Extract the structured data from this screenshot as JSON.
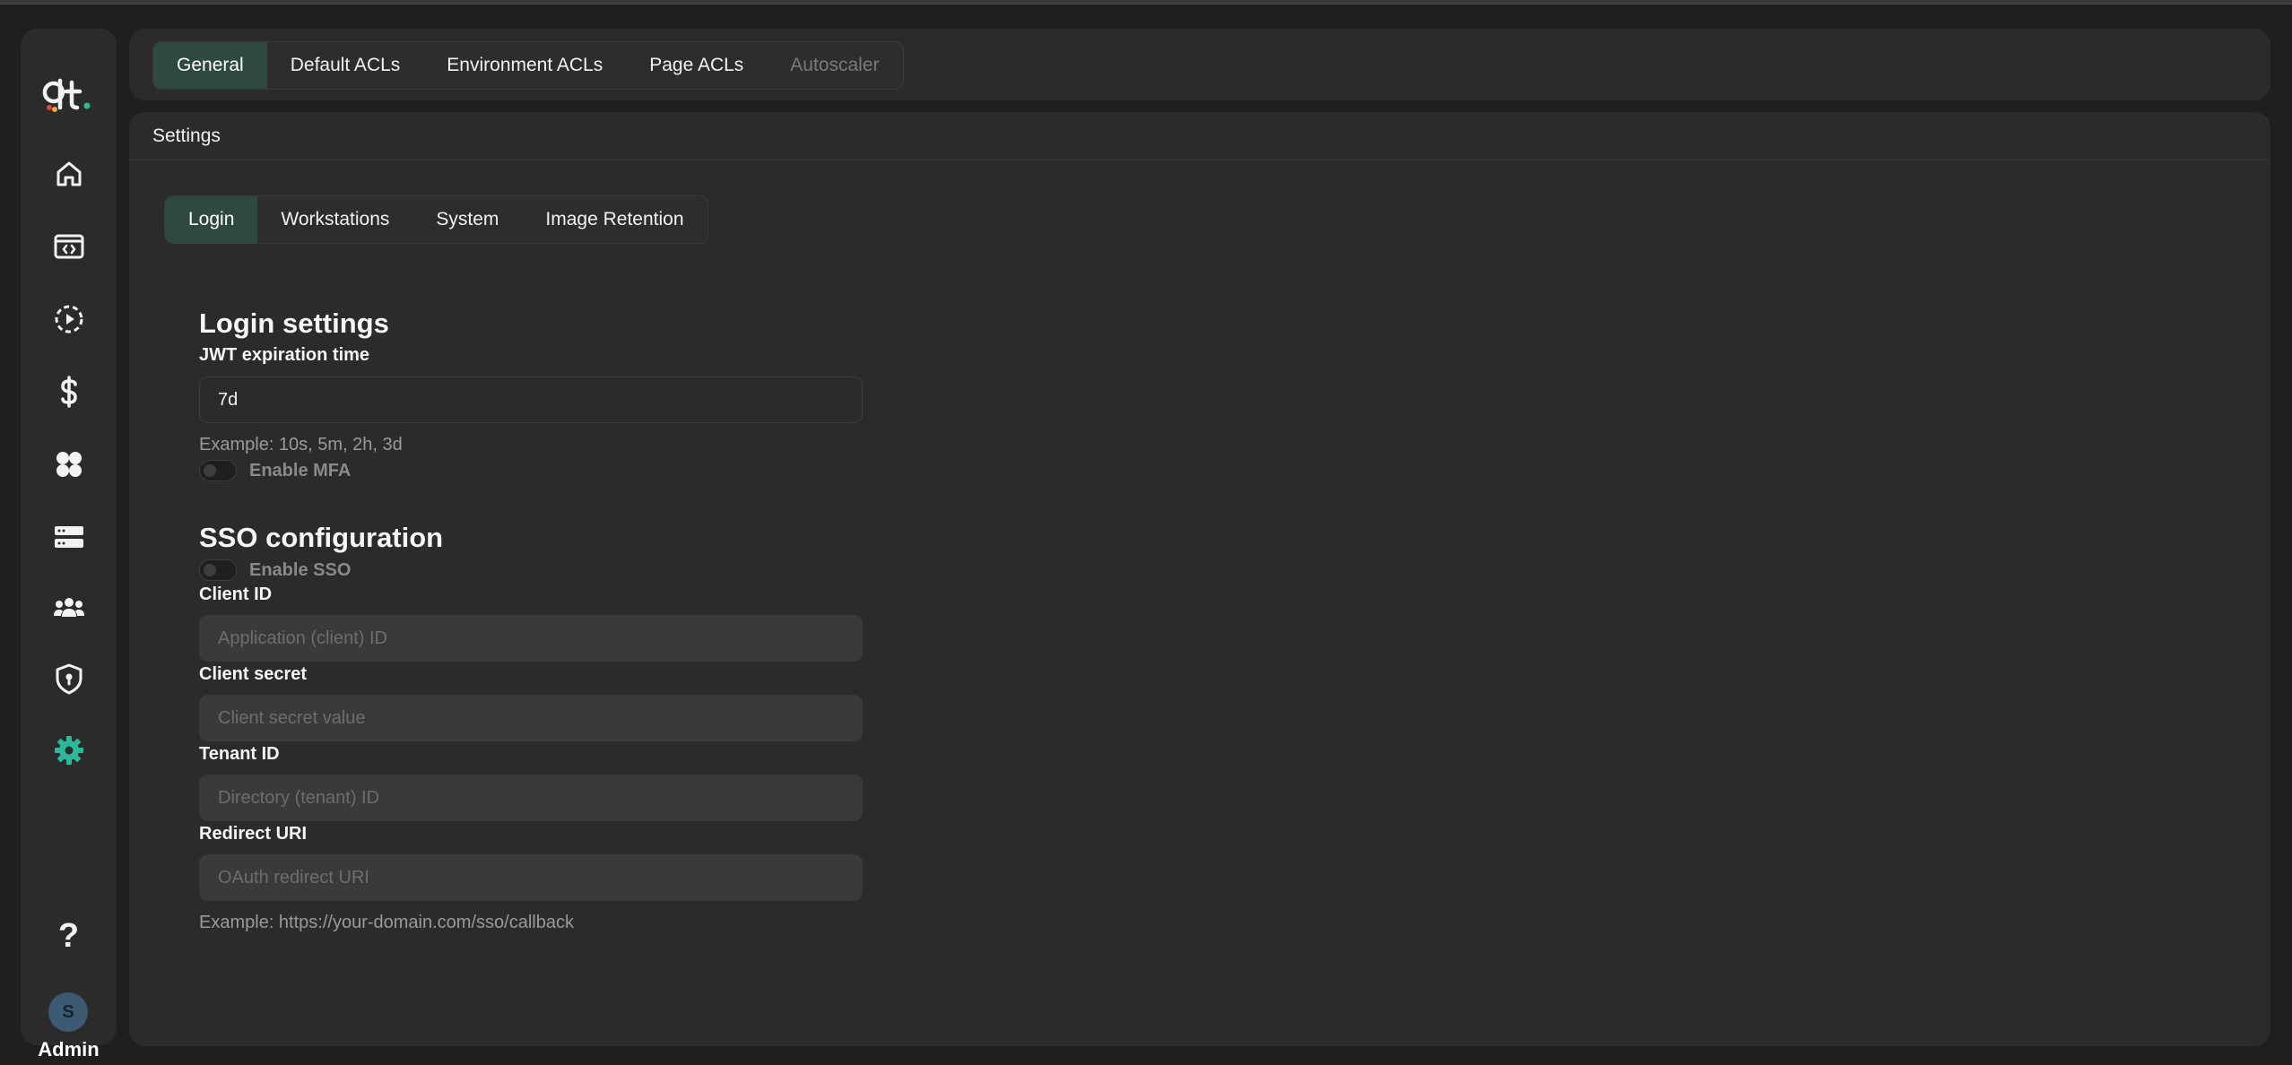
{
  "user": {
    "initial": "S",
    "role": "Admin"
  },
  "colors": {
    "accent": "#2eb89a",
    "active_tab": "#2e4a3e"
  },
  "sidebar": {
    "items": [
      {
        "icon": "home-icon"
      },
      {
        "icon": "code-window-icon"
      },
      {
        "icon": "session-play-icon"
      },
      {
        "icon": "dollar-icon"
      },
      {
        "icon": "apps-grid-icon"
      },
      {
        "icon": "server-icon"
      },
      {
        "icon": "users-icon"
      },
      {
        "icon": "shield-lock-icon"
      },
      {
        "icon": "gear-icon",
        "active": true
      },
      {
        "icon": "help-icon",
        "label": "?"
      }
    ]
  },
  "top_tabs": [
    {
      "label": "General",
      "active": true
    },
    {
      "label": "Default ACLs"
    },
    {
      "label": "Environment ACLs"
    },
    {
      "label": "Page ACLs"
    },
    {
      "label": "Autoscaler",
      "disabled": true
    }
  ],
  "card": {
    "title": "Settings"
  },
  "sub_tabs": [
    {
      "label": "Login",
      "active": true
    },
    {
      "label": "Workstations"
    },
    {
      "label": "System"
    },
    {
      "label": "Image Retention"
    }
  ],
  "login": {
    "title": "Login settings",
    "jwt_label": "JWT expiration time",
    "jwt_value": "7d",
    "jwt_hint": "Example: 10s, 5m, 2h, 3d",
    "mfa_label": "Enable MFA",
    "mfa_enabled": false
  },
  "sso": {
    "title": "SSO configuration",
    "enable_label": "Enable SSO",
    "enabled": false,
    "client_id_label": "Client ID",
    "client_id_placeholder": "Application (client) ID",
    "client_secret_label": "Client secret",
    "client_secret_placeholder": "Client secret value",
    "tenant_id_label": "Tenant ID",
    "tenant_id_placeholder": "Directory (tenant) ID",
    "redirect_label": "Redirect URI",
    "redirect_placeholder": "OAuth redirect URI",
    "redirect_hint": "Example: https://your-domain.com/sso/callback"
  }
}
